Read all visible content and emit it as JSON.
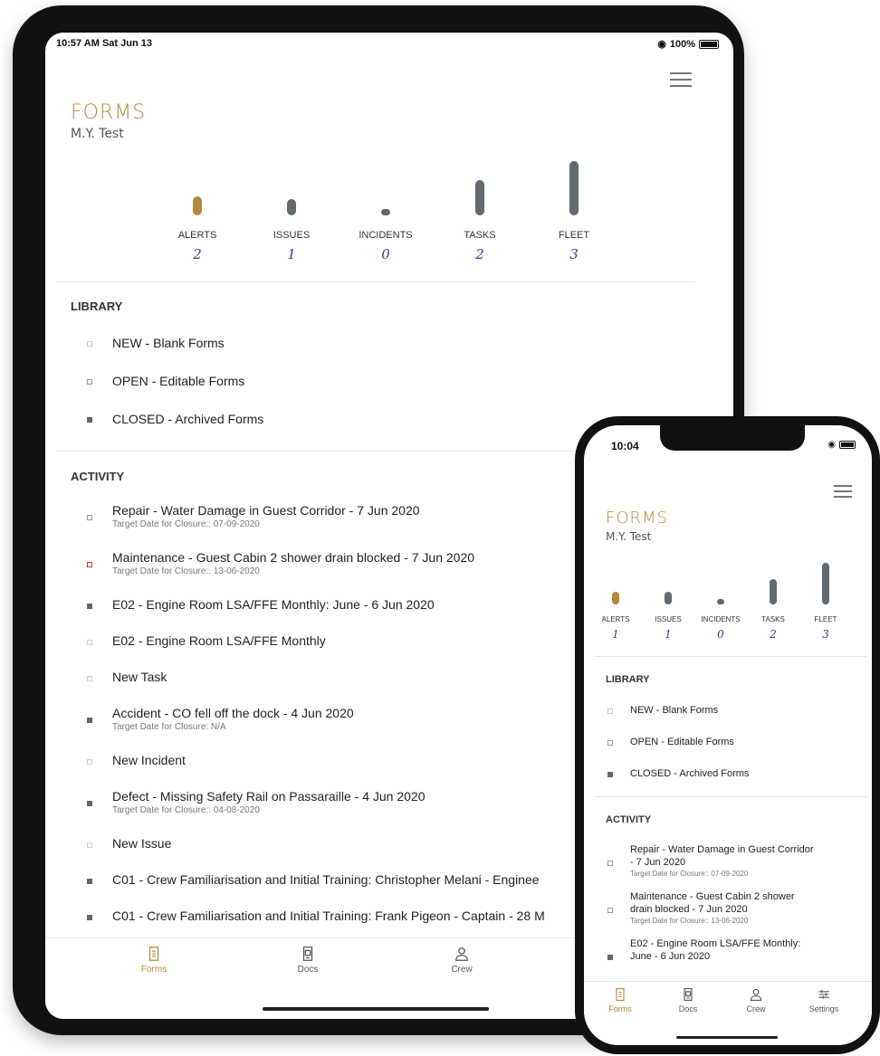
{
  "ipad": {
    "status": {
      "time": "10:57 AM  Sat Jun 13",
      "wifi": "◉",
      "battery": "100%"
    },
    "title": "FORMS",
    "vessel": "M.Y. Test",
    "stats": [
      {
        "label": "ALERTS",
        "count": "2",
        "level": 0.35,
        "gold": true
      },
      {
        "label": "ISSUES",
        "count": "1",
        "level": 0.3,
        "gold": false
      },
      {
        "label": "INCIDENTS",
        "count": "0",
        "level": 0.1,
        "gold": false
      },
      {
        "label": "TASKS",
        "count": "2",
        "level": 0.65,
        "gold": false
      },
      {
        "label": "FLEET",
        "count": "3",
        "level": 1.0,
        "gold": false
      }
    ],
    "library_heading": "LIBRARY",
    "library": [
      {
        "label": "NEW - Blank Forms",
        "bullet": "empty-light"
      },
      {
        "label": "OPEN - Editable Forms",
        "bullet": "empty"
      },
      {
        "label": "CLOSED - Archived Forms",
        "bullet": "filled"
      }
    ],
    "activity_heading": "ACTIVITY",
    "activity": [
      {
        "title": "Repair - Water Damage in Guest Corridor  - 7 Jun 2020",
        "sub": "Target Date for Closure:: 07-09-2020",
        "bullet": "empty"
      },
      {
        "title": "Maintenance - Guest Cabin 2 shower drain blocked  - 7 Jun 2020",
        "sub": "Target Date for Closure:: 13-06-2020",
        "bullet": "red"
      },
      {
        "title": "E02 - Engine Room LSA/FFE Monthly: June  - 6 Jun 2020",
        "sub": "",
        "bullet": "filled"
      },
      {
        "title": "E02 - Engine Room LSA/FFE Monthly",
        "sub": "",
        "bullet": "empty-light"
      },
      {
        "title": "New Task",
        "sub": "",
        "bullet": "empty-light"
      },
      {
        "title": "Accident - CO fell off the dock  - 4 Jun 2020",
        "sub": "Target Date for Closure: N/A",
        "bullet": "filled"
      },
      {
        "title": "New Incident",
        "sub": "",
        "bullet": "empty-light"
      },
      {
        "title": "Defect - Missing Safety Rail on Passaraille  - 4 Jun 2020",
        "sub": "Target Date for Closure:: 04-08-2020",
        "bullet": "filled"
      },
      {
        "title": "New Issue",
        "sub": "",
        "bullet": "empty-light"
      },
      {
        "title": "C01 - Crew Familiarisation and Initial Training: Christopher Melani - Enginee",
        "sub": "",
        "bullet": "filled"
      },
      {
        "title": "C01 - Crew Familiarisation and Initial Training: Frank Pigeon - Captain  - 28 M",
        "sub": "",
        "bullet": "filled"
      }
    ],
    "tabs": [
      {
        "label": "Forms",
        "icon": "forms-icon",
        "active": true
      },
      {
        "label": "Docs",
        "icon": "docs-icon",
        "active": false
      },
      {
        "label": "Crew",
        "icon": "crew-icon",
        "active": false
      }
    ]
  },
  "phone": {
    "status": {
      "time": "10:04"
    },
    "title": "FORMS",
    "vessel": "M.Y. Test",
    "stats": [
      {
        "label": "ALERTS",
        "count": "1",
        "level": 0.3,
        "gold": true
      },
      {
        "label": "ISSUES",
        "count": "1",
        "level": 0.3,
        "gold": false
      },
      {
        "label": "INCIDENTS",
        "count": "0",
        "level": 0.1,
        "gold": false
      },
      {
        "label": "TASKS",
        "count": "2",
        "level": 0.6,
        "gold": false
      },
      {
        "label": "FLEET",
        "count": "3",
        "level": 1.0,
        "gold": false
      }
    ],
    "library_heading": "LIBRARY",
    "library": [
      {
        "label": "NEW - Blank Forms",
        "bullet": "empty-light"
      },
      {
        "label": "OPEN - Editable Forms",
        "bullet": "empty"
      },
      {
        "label": "CLOSED - Archived Forms",
        "bullet": "filled"
      }
    ],
    "activity_heading": "ACTIVITY",
    "activity": [
      {
        "title1": "Repair - Water Damage in Guest Corridor",
        "title2": "- 7 Jun 2020",
        "sub": "Target Date for Closure:: 07-09-2020",
        "bullet": "empty"
      },
      {
        "title1": "Maintenance - Guest Cabin 2 shower",
        "title2": "drain blocked  - 7 Jun 2020",
        "sub": "Target Date for Closure:: 13-06-2020",
        "bullet": "empty"
      },
      {
        "title1": "E02 - Engine Room LSA/FFE Monthly:",
        "title2": "June  - 6 Jun 2020",
        "sub": "",
        "bullet": "filled"
      }
    ],
    "tabs": [
      {
        "label": "Forms",
        "icon": "forms-icon",
        "active": true
      },
      {
        "label": "Docs",
        "icon": "docs-icon",
        "active": false
      },
      {
        "label": "Crew",
        "icon": "crew-icon",
        "active": false
      },
      {
        "label": "Settings",
        "icon": "settings-icon",
        "active": false
      }
    ]
  },
  "colors": {
    "accent": "#b38a3d",
    "bar": "#5f6b70",
    "count": "#34418c",
    "alert": "#cc3333"
  }
}
